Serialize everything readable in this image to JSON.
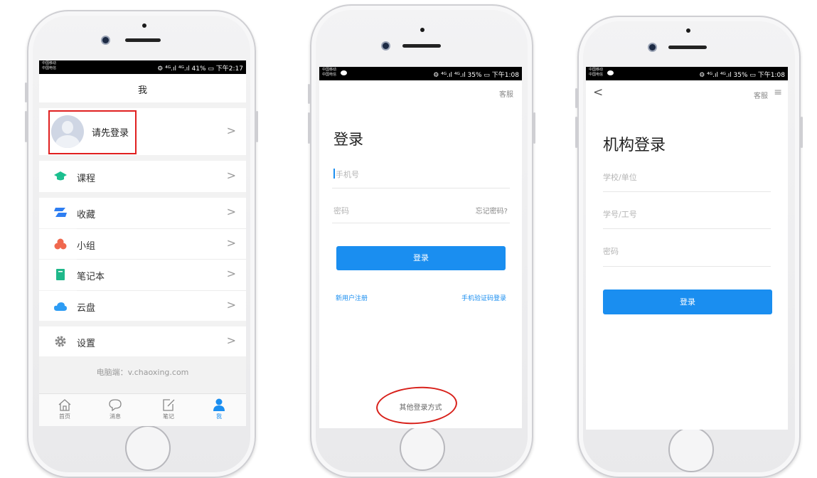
{
  "screen1": {
    "status_left": "中国移动\n中国电信",
    "status_right": "⚙ ⁴ᴳ.ıl ⁴ᴳ.ıl 41% ▭ 下午2:17",
    "title": "我",
    "login_prompt": "请先登录",
    "menu": [
      {
        "label": "课程",
        "icon": "graduation-cap-icon",
        "color": "#1bbf8f"
      },
      {
        "label": "收藏",
        "icon": "bookmark-stack-icon",
        "color": "#2e7ef2"
      },
      {
        "label": "小组",
        "icon": "group-circles-icon",
        "color": "#f0684e"
      },
      {
        "label": "笔记本",
        "icon": "notebook-icon",
        "color": "#1fb88a"
      },
      {
        "label": "云盘",
        "icon": "cloud-icon",
        "color": "#2d9cf4"
      },
      {
        "label": "设置",
        "icon": "gear-icon",
        "color": "#888888"
      }
    ],
    "footer_note": "电脑端：v.chaoxing.com",
    "tabs": [
      {
        "label": "首页",
        "icon": "home-icon"
      },
      {
        "label": "消息",
        "icon": "message-icon"
      },
      {
        "label": "笔记",
        "icon": "note-edit-icon"
      },
      {
        "label": "我",
        "icon": "user-icon",
        "active": true
      }
    ],
    "highlight_color": "#e02020"
  },
  "screen2": {
    "status_right": "⚙ ⁴ᴳ.ıl ⁴ᴳ.ıl 35% ▭ 下午1:08",
    "service": "客服",
    "title": "登录",
    "phone_placeholder": "手机号",
    "password_placeholder": "密码",
    "forgot": "忘记密码?",
    "login_button": "登录",
    "register": "新用户注册",
    "sms_login": "手机验证码登录",
    "other_login": "其他登录方式",
    "accent": "#1a8ef0"
  },
  "screen3": {
    "status_right": "⚙ ⁴ᴳ.ıl ⁴ᴳ.ıl 35% ▭ 下午1:08",
    "back": "<",
    "service": "客服",
    "menu_icon": "≡",
    "title": "机构登录",
    "school_placeholder": "学校/单位",
    "id_placeholder": "学号/工号",
    "password_placeholder": "密码",
    "login_button": "登录"
  }
}
